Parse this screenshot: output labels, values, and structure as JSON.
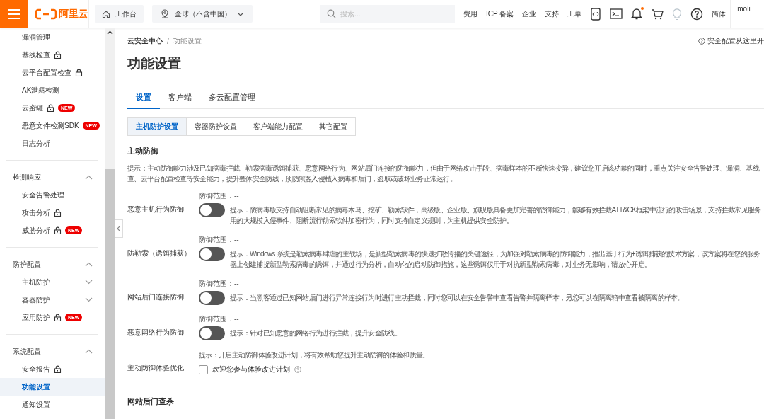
{
  "topbar": {
    "logo": "阿里云",
    "workbench": "工作台",
    "region": "全球（不含中国）",
    "search_placeholder": "搜索...",
    "links": [
      "费用",
      "ICP 备案",
      "企业",
      "支持",
      "工单"
    ],
    "notification_dot": true,
    "language": "简体",
    "user": "moli"
  },
  "sidebar": {
    "sections": [
      {
        "items": [
          {
            "label": "漏洞管理",
            "lock": false,
            "selected": false
          },
          {
            "label": "基线检查",
            "lock": true,
            "selected": false
          },
          {
            "label": "云平台配置检查",
            "lock": true,
            "selected": false
          },
          {
            "label": "AK泄露检测",
            "lock": false,
            "selected": false
          },
          {
            "label": "云蜜罐",
            "lock": true,
            "badge": "NEW",
            "selected": false
          },
          {
            "label": "恶意文件检测SDK",
            "lock": false,
            "badge": "NEW",
            "selected": false
          },
          {
            "label": "日志分析",
            "lock": false,
            "selected": false
          }
        ]
      },
      {
        "title": "检测响应",
        "expanded": true,
        "items": [
          {
            "label": "安全告警处理",
            "lock": false,
            "selected": false
          },
          {
            "label": "攻击分析",
            "lock": true,
            "selected": false
          },
          {
            "label": "威胁分析",
            "lock": true,
            "badge": "NEW",
            "selected": false
          }
        ]
      },
      {
        "title": "防护配置",
        "expanded": true,
        "items": [
          {
            "label": "主机防护",
            "lock": false,
            "selected": false,
            "expanded": false
          },
          {
            "label": "容器防护",
            "lock": false,
            "selected": false,
            "expanded": false
          },
          {
            "label": "应用防护",
            "lock": true,
            "badge": "NEW",
            "selected": false
          }
        ]
      },
      {
        "title": "系统配置",
        "expanded": true,
        "items": [
          {
            "label": "安全报告",
            "lock": true,
            "selected": false
          },
          {
            "label": "功能设置",
            "lock": false,
            "selected": true
          },
          {
            "label": "通知设置",
            "lock": false,
            "selected": false
          }
        ]
      }
    ]
  },
  "breadcrumb": [
    "云安全中心",
    "功能设置"
  ],
  "breadcrumb_separator": "/",
  "help_link": "安全配置从这里开",
  "page_title": "功能设置",
  "tabs": [
    {
      "label": "设置",
      "selected": true
    },
    {
      "label": "客户端",
      "selected": false
    },
    {
      "label": "多云配置管理",
      "selected": false
    }
  ],
  "subtabs": [
    {
      "label": "主机防护设置",
      "selected": true
    },
    {
      "label": "容器防护设置",
      "selected": false
    },
    {
      "label": "客户端能力配置",
      "selected": false
    },
    {
      "label": "其它配置",
      "selected": false
    }
  ],
  "section": {
    "title": "主动防御",
    "hint_lines": [
      "提示：主动防御能力涉及已知病毒拦截、勒索病毒诱饵捕获、恶意网络行为、网站后门连接的防御能力，但由于网络攻击手段、病毒样本的不断快速变异，建议您开启该功能的同时，重点关注安全告警处理、漏洞、基线",
      "查、云平台配置检查等安全能力，提升整体安全防线，预防黑客入侵植入病毒和后门，盗取或破坏业务正常运行。"
    ],
    "rows": [
      {
        "kind": "toggle",
        "label": "恶意主机行为防御",
        "scope": "防御范围：--",
        "on": false,
        "hint_lines": [
          "提示：防病毒版支持自动阻断常见的病毒木马、挖矿、勒索软件，高级版、企业版、旗舰版具备更加完善的防御能力，能够有效拦截ATT&CK框架中流行的攻击场景，支持拦截常见服务",
          "用的大规模入侵事件、阻断流行勒索软件加密行为，同时支持自定义规则，为主机提供安全防护。"
        ]
      },
      {
        "kind": "toggle",
        "label": "防勒索（诱饵捕获）",
        "scope": "防御范围：--",
        "on": false,
        "hint_lines": [
          "提示：Windows 系统是勒索病毒肆虐的主战场，是新型勒索病毒的快速扩散传播的关键途径，为加强对勒索病毒的防御能力，推出基于行为+诱饵捕获的技术方案，该方案将在您的服务",
          "器上创建捕捉新型勒索病毒的诱饵，并通过行为分析，自动化的启动防御措施，这些诱饵仅用于对抗新型勒索病毒，对业务无影响，请放心开启。"
        ]
      },
      {
        "kind": "toggle",
        "label": "网站后门连接防御",
        "scope": "防御范围：--",
        "on": false,
        "hint_lines": [
          "提示：当黑客通过已知网站后门进行异常连接行为时进行主动拦截，同时您可以在安全告警中查看告警并隔离样本，另您可以在隔离箱中查看被隔离的样本。"
        ]
      },
      {
        "kind": "toggle",
        "label": "恶意网络行为防御",
        "scope": "防御范围：--",
        "on": false,
        "hint_lines": [
          "提示：针对已知恶意的网络行为进行拦截，提升安全防线。"
        ]
      },
      {
        "kind": "checkbox",
        "label": "主动防御体验优化",
        "hint_lines": [
          "提示：开启主动防御体验改进计划，将有效帮助您提升主动防御的体验和质量。"
        ],
        "checkbox_label": "欢迎您参与体验改进计划",
        "checked": false
      }
    ]
  },
  "next_section": {
    "title": "网站后门查杀"
  }
}
